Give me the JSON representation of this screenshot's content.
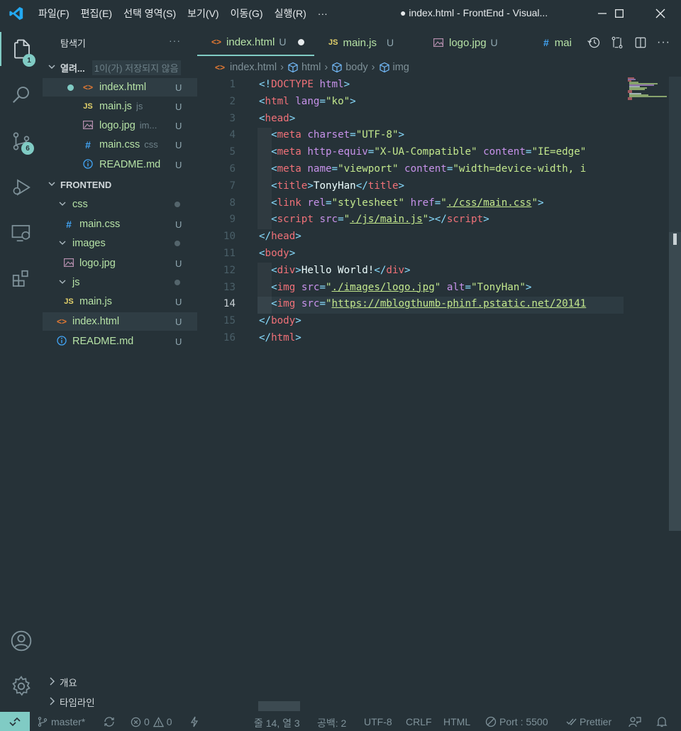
{
  "titlebar": {
    "menu": [
      "파일(F)",
      "편집(E)",
      "선택 영역(S)",
      "보기(V)",
      "이동(G)",
      "실행(R)",
      "···"
    ],
    "window_title": "● index.html - FrontEnd - Visual..."
  },
  "activity": {
    "explorer_badge": "1",
    "scm_badge": "6"
  },
  "sidebar": {
    "title": "탐색기",
    "more": "···",
    "open_editors_label": "열려...",
    "open_editors_desc": "1이(가) 저장되지 않음",
    "open_editors": [
      {
        "name": "index.html",
        "desc": "",
        "status": "U",
        "icon": "html-icon"
      },
      {
        "name": "main.js",
        "desc": "js",
        "status": "U",
        "icon": "js-icon"
      },
      {
        "name": "logo.jpg",
        "desc": "im...",
        "status": "U",
        "icon": "image-icon"
      },
      {
        "name": "main.css",
        "desc": "css",
        "status": "U",
        "icon": "css-icon"
      },
      {
        "name": "README.md",
        "desc": "",
        "status": "U",
        "icon": "info-icon"
      }
    ],
    "project": "FRONTEND",
    "tree": {
      "css_folder": "css",
      "css_file": "main.css",
      "images_folder": "images",
      "images_file": "logo.jpg",
      "js_folder": "js",
      "js_file": "main.js",
      "index": "index.html",
      "readme": "README.md",
      "u": "U"
    },
    "outline": "개요",
    "timeline": "타임라인"
  },
  "tabs": [
    {
      "name": "index.html",
      "status": "U"
    },
    {
      "name": "main.js",
      "status": "U"
    },
    {
      "name": "logo.jpg",
      "status": "U"
    },
    {
      "name": "mai",
      "status": ""
    }
  ],
  "breadcrumb": [
    "index.html",
    "html",
    "body",
    "img"
  ],
  "editor": {
    "line_numbers": [
      "1",
      "2",
      "3",
      "4",
      "5",
      "6",
      "7",
      "8",
      "9",
      "10",
      "11",
      "12",
      "13",
      "14",
      "15",
      "16"
    ],
    "current_line": "14",
    "lines": {
      "l1_doctype": "DOCTYPE",
      "l1_html": "html",
      "l2_tag": "html",
      "l2_attr": "lang",
      "l2_val": "\"ko\"",
      "l3_tag": "head",
      "l4_tag": "meta",
      "l4_attr": "charset",
      "l4_val": "\"UTF-8\"",
      "l5_tag": "meta",
      "l5_attr1": "http-equiv",
      "l5_val1": "\"X-UA-Compatible\"",
      "l5_attr2": "content",
      "l5_val2": "\"IE=edge\"",
      "l6_tag": "meta",
      "l6_attr1": "name",
      "l6_val1": "\"viewport\"",
      "l6_attr2": "content",
      "l6_val2": "\"width=device-width, i",
      "l7_tag": "title",
      "l7_text": "TonyHan",
      "l8_tag": "link",
      "l8_attr1": "rel",
      "l8_val1": "\"stylesheet\"",
      "l8_attr2": "href",
      "l8_link": "./css/main.css",
      "l9_tag": "script",
      "l9_attr": "src",
      "l9_link": "./js/main.js",
      "l10_tag": "head",
      "l11_tag": "body",
      "l12_tag": "div",
      "l12_text": "Hello World!",
      "l13_tag": "img",
      "l13_attr1": "src",
      "l13_link": "./images/logo.jpg",
      "l13_attr2": "alt",
      "l13_val2": "\"TonyHan\"",
      "l14_tag": "img",
      "l14_attr": "src",
      "l14_link": "https://mblogthumb-phinf.pstatic.net/20141",
      "l15_tag": "body",
      "l16_tag": "html"
    }
  },
  "statusbar": {
    "branch": "master*",
    "errors": "0",
    "warnings": "0",
    "position": "줄 14, 열 3",
    "spaces": "공백: 2",
    "encoding": "UTF-8",
    "eol": "CRLF",
    "language": "HTML",
    "port": "Port : 5500",
    "prettier": "Prettier"
  },
  "colors": {
    "background": "#263238",
    "accent": "#80cbc4",
    "file_untracked": "#b6e2a6"
  }
}
